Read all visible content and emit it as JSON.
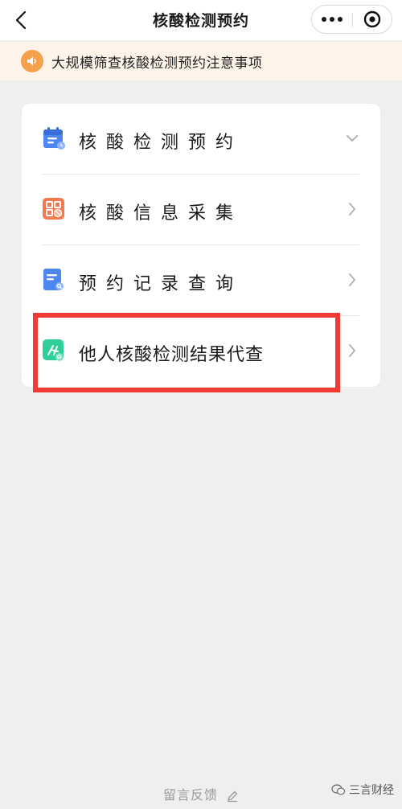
{
  "header": {
    "title": "核酸检测预约"
  },
  "notice": {
    "text": "大规模筛查核酸检测预约注意事项"
  },
  "menu": {
    "items": [
      {
        "label": "核酸检测预约",
        "icon": "calendar-icon",
        "indicator": "chevron-down"
      },
      {
        "label": "核酸信息采集",
        "icon": "qr-scan-icon",
        "indicator": "chevron-right"
      },
      {
        "label": "预约记录查询",
        "icon": "record-search-icon",
        "indicator": "chevron-right"
      },
      {
        "label": "他人核酸检测结果代查",
        "icon": "proxy-query-icon",
        "indicator": "chevron-right"
      }
    ]
  },
  "footer": {
    "feedback_label": "留言反馈"
  },
  "watermark": {
    "text": "三言财经"
  },
  "colors": {
    "notice_bg": "#fdf3e8",
    "notice_icon": "#f5a04a",
    "highlight_border": "#f03a33",
    "page_bg": "#efefef"
  }
}
